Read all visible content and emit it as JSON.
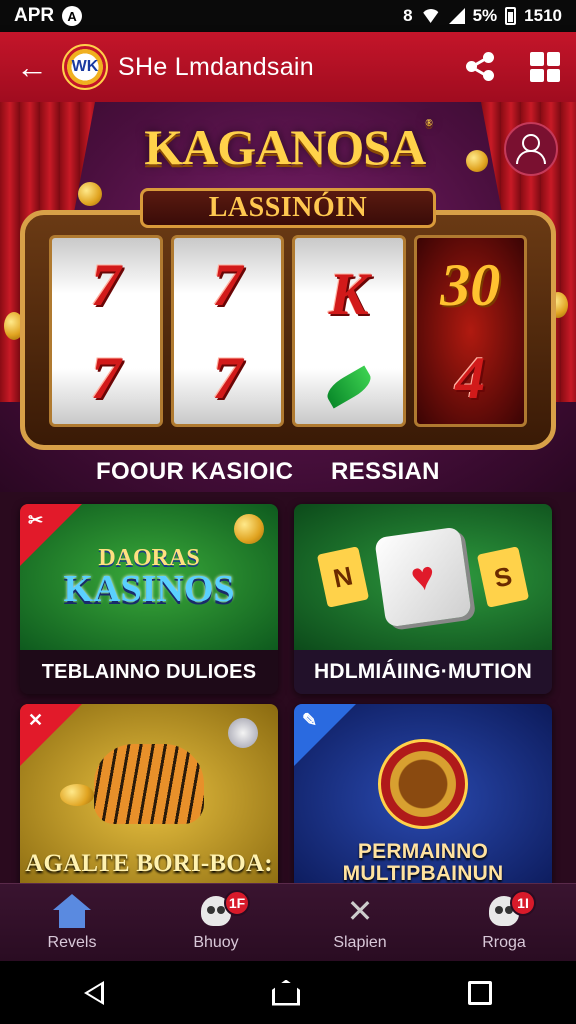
{
  "status_bar": {
    "carrier": "APR",
    "indicator": "8",
    "icon_name": "signal-icon",
    "battery_text": "5%",
    "time": "1510"
  },
  "app_bar": {
    "logo_text": "WK",
    "title": "SHe Lmdandsain",
    "icons": [
      "back-arrow-icon",
      "share-icon",
      "menu-grid-icon"
    ]
  },
  "hero": {
    "brand": "KAGANOSA",
    "registered": "®",
    "plaque": "LASSINÓIN",
    "reels": [
      [
        "7",
        "7"
      ],
      [
        "7",
        "7"
      ],
      [
        "K",
        "leaf"
      ],
      [
        "30",
        "4"
      ]
    ],
    "label_left": "FOOUR KASIOIC",
    "label_right": "RESSIAN"
  },
  "tiles": [
    {
      "ribbon": "✂",
      "title_top": "DAORAS",
      "title_main": "KASINOS",
      "caption": "TEBLAINNO DULIOES",
      "ribbon_color": "#e21a2a"
    },
    {
      "card_left": "N",
      "card_right": "S",
      "caption": "HDLMIÁIING·MUTION"
    },
    {
      "ribbon": "✕",
      "caption": "AGALTE BORI-BOA:",
      "ribbon_color": "#e21a2a"
    },
    {
      "ribbon": "✎",
      "caption_line1": "PERMAINNO",
      "caption_line2": "MULTIPBAINUN",
      "ribbon_color": "#2a6ae0"
    }
  ],
  "bottom_nav": [
    {
      "label": "Revels",
      "icon": "home-icon"
    },
    {
      "label": "Bhuoy",
      "icon": "skull-icon",
      "badge": "1F"
    },
    {
      "label": "Slapien",
      "icon": "crossed-tools-icon"
    },
    {
      "label": "Rroga",
      "icon": "skull-icon",
      "badge": "1I"
    }
  ],
  "system_nav": [
    "back-icon",
    "home-icon",
    "recents-icon"
  ],
  "colors": {
    "app_bar": "#c4152a",
    "background": "#2a0a1e",
    "gold": "#ffd24a"
  }
}
